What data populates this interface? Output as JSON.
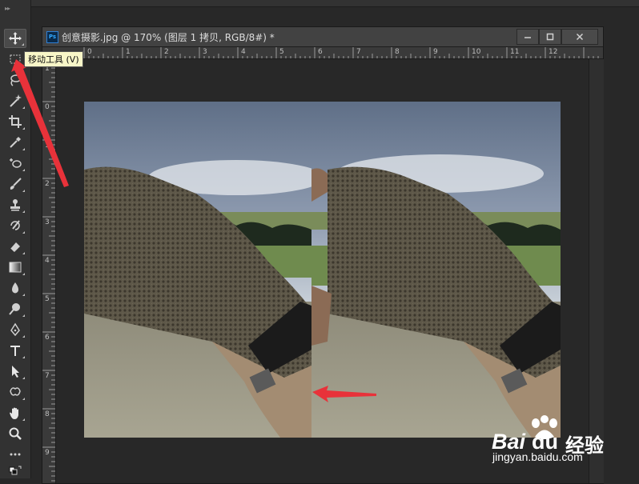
{
  "toolbar": {
    "collapse": "▸▸",
    "tools": [
      "move",
      "marquee",
      "lasso",
      "magic-wand",
      "crop",
      "eyedropper",
      "healing",
      "brush",
      "stamp",
      "history-brush",
      "eraser",
      "gradient",
      "blur",
      "dodge",
      "pen",
      "type",
      "path-select",
      "shape",
      "hand",
      "zoom",
      "more",
      "swap-colors"
    ],
    "tooltip": "移动工具 (V)"
  },
  "document": {
    "title": "创意摄影.jpg @ 170% (图层 1 拷贝, RGB/8#) *",
    "ps_icon": "Ps",
    "ruler_h": [
      "0",
      "1",
      "2",
      "3",
      "4",
      "5",
      "6",
      "7",
      "8",
      "9",
      "10",
      "11",
      "12"
    ],
    "ruler_v": [
      "1",
      "0",
      "1",
      "2",
      "3",
      "4",
      "5",
      "6",
      "7",
      "8",
      "9"
    ]
  },
  "watermark": {
    "brand": "Bai",
    "brand2": "du",
    "cn": "经验",
    "url": "jingyan.baidu.com"
  },
  "colors": {
    "annotation_arrow": "#e8323a",
    "panel": "#323232",
    "canvas": "#282828"
  }
}
